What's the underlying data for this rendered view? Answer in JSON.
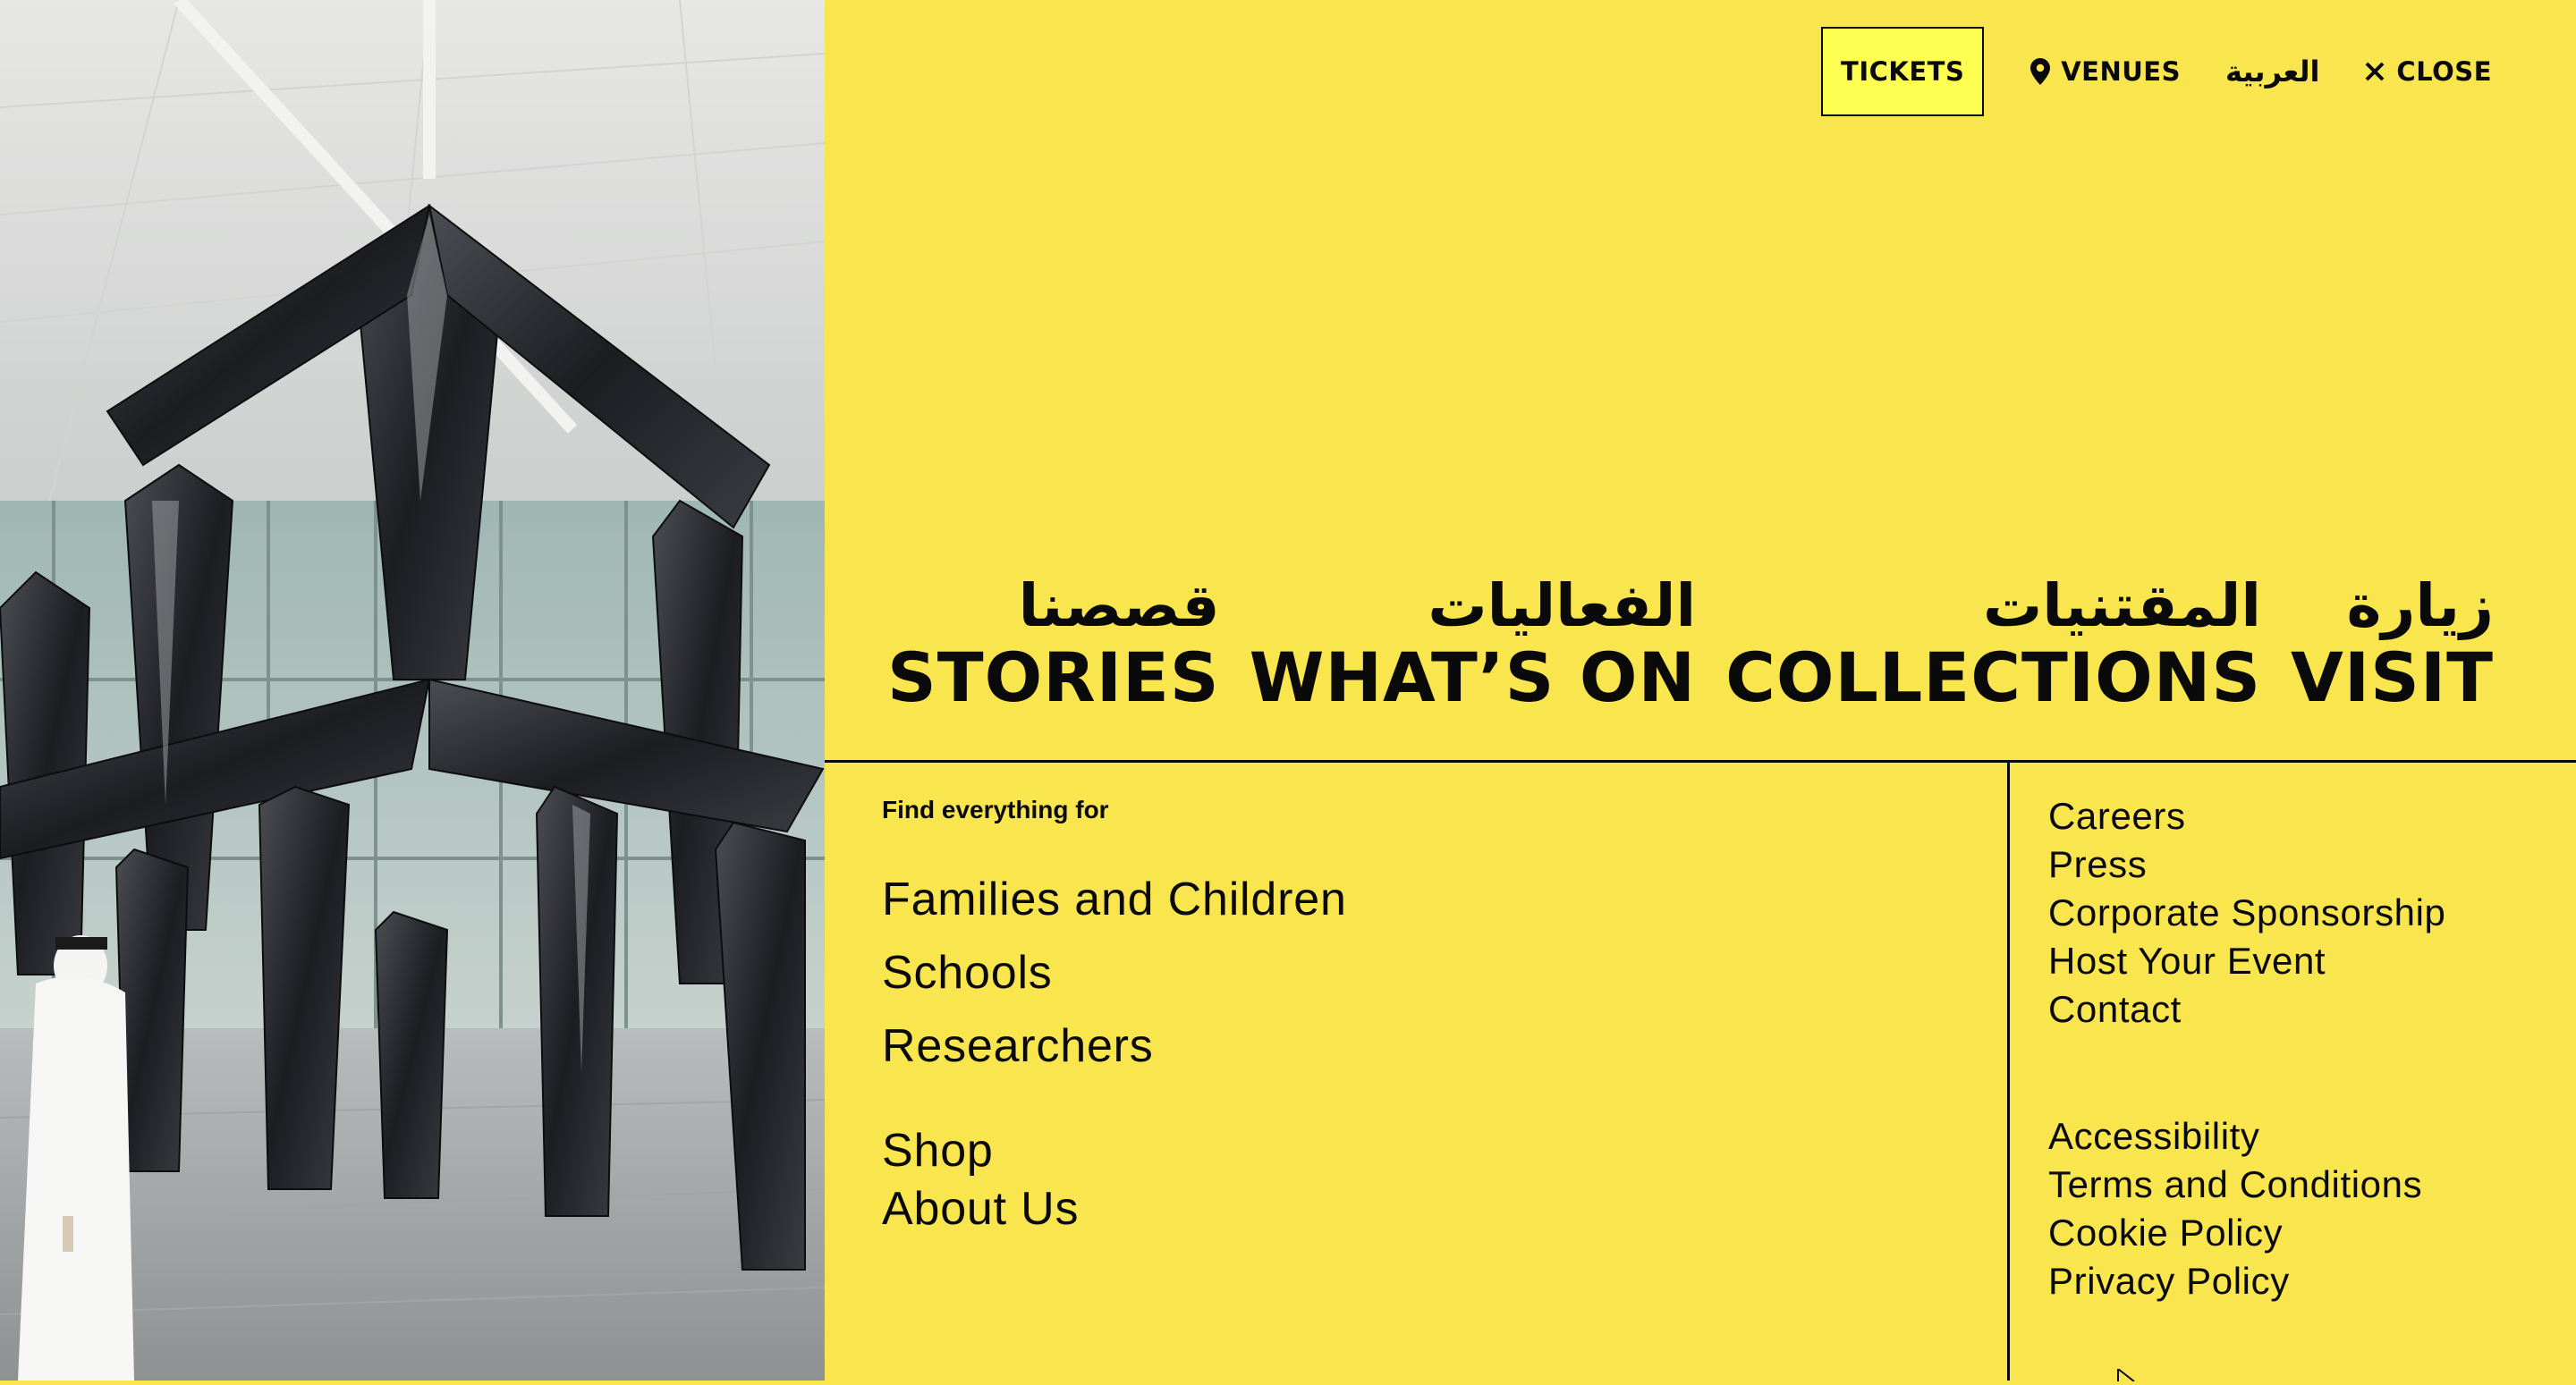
{
  "header": {
    "tickets_label": "TICKETS",
    "venues_label": "VENUES",
    "language_label": "العربية",
    "close_label": "CLOSE"
  },
  "icons": {
    "venues": "map-pin-icon",
    "close": "close-icon"
  },
  "nav": [
    {
      "arabic": "قصصنا",
      "english": "STORIES"
    },
    {
      "arabic": "الفعاليات",
      "english": "WHAT’S ON"
    },
    {
      "arabic": "المقتنيات",
      "english": "COLLECTIONS"
    },
    {
      "arabic": "زيارة",
      "english": "VISIT"
    }
  ],
  "audience": {
    "title": "Find everything for",
    "items": [
      "Families and Children",
      "Schools",
      "Researchers"
    ]
  },
  "misc_links": [
    "Shop",
    "About Us"
  ],
  "right_links_primary": [
    "Careers",
    "Press",
    "Corporate Sponsorship",
    "Host Your Event",
    "Contact"
  ],
  "right_links_secondary": [
    "Accessibility",
    "Terms and Conditions",
    "Cookie Policy",
    "Privacy Policy"
  ],
  "colors": {
    "panel_background": "#f9e54e",
    "tickets_background": "#ffff52",
    "text": "#0a0a0a"
  }
}
